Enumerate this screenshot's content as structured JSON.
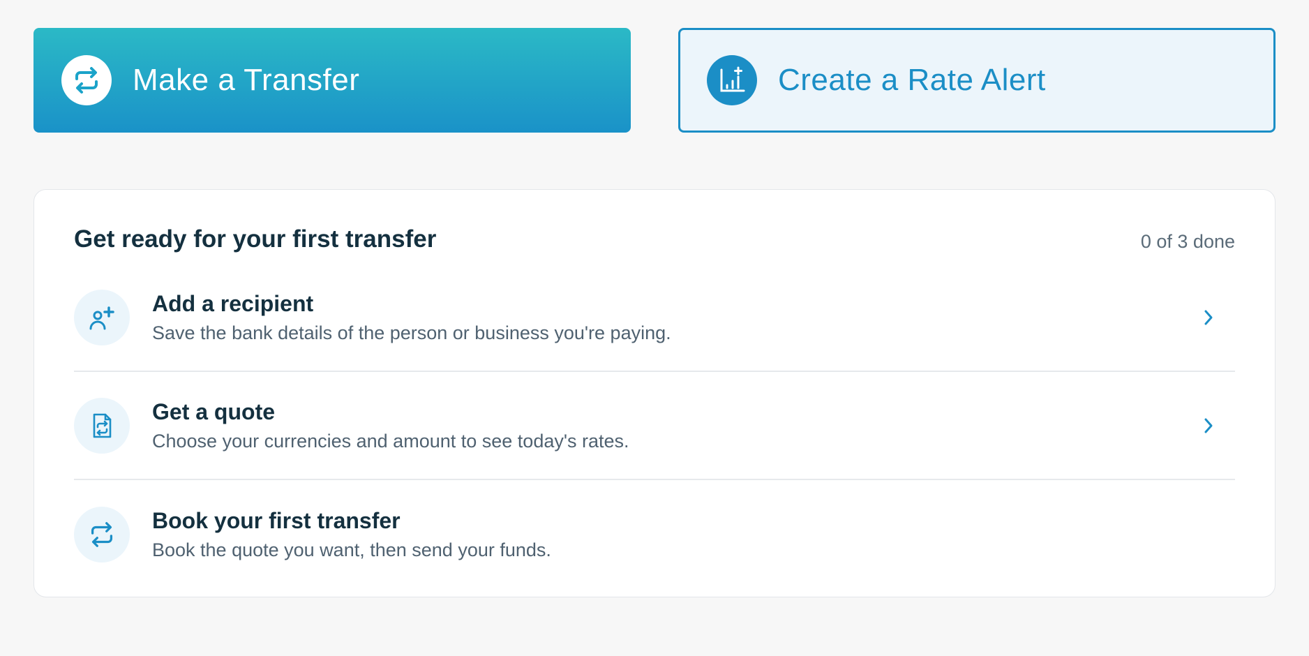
{
  "actions": {
    "transfer": {
      "label": "Make a Transfer",
      "icon": "transfer-arrows-icon"
    },
    "rate_alert": {
      "label": "Create a Rate Alert",
      "icon": "chart-plus-icon"
    }
  },
  "checklist": {
    "title": "Get ready for your first transfer",
    "progress": "0 of 3 done",
    "steps": [
      {
        "title": "Add a recipient",
        "description": "Save the bank details of the person or business you're paying.",
        "icon": "add-person-icon"
      },
      {
        "title": "Get a quote",
        "description": "Choose your currencies and amount to see today's rates.",
        "icon": "quote-document-icon"
      },
      {
        "title": "Book your first transfer",
        "description": "Book the quote you want, then send your funds.",
        "icon": "transfer-arrows-icon"
      }
    ]
  },
  "colors": {
    "brand_blue": "#1b8ec6",
    "teal_gradient_start": "#2bb9c6",
    "dark_text": "#14303f",
    "muted_text": "#4f6170",
    "page_bg": "#f7f7f7"
  }
}
